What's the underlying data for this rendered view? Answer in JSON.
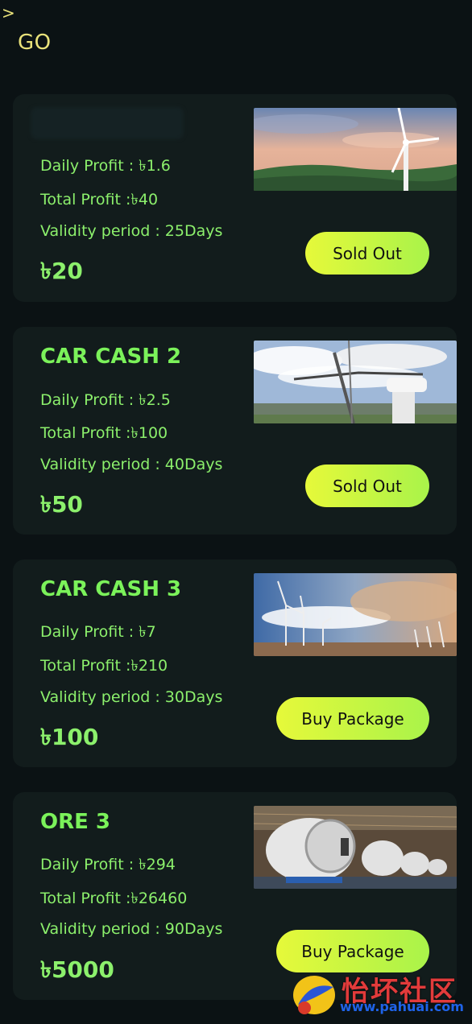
{
  "header": {
    "chevron": ">",
    "go_label": "GO"
  },
  "packages": [
    {
      "title": "",
      "daily_profit": "Daily Profit : ৳1.6",
      "total_profit": "Total Profit :৳40",
      "validity": "Validity period : 25Days",
      "price": "৳20",
      "button": "Sold Out",
      "image": "wind-turbine-sunset"
    },
    {
      "title": "CAR CASH 2",
      "daily_profit": "Daily Profit : ৳2.5",
      "total_profit": "Total Profit :৳100",
      "validity": "Validity period : 40Days",
      "price": "৳50",
      "button": "Sold Out",
      "image": "turbine-crane-construction"
    },
    {
      "title": "CAR CASH 3",
      "daily_profit": "Daily Profit : ৳7",
      "total_profit": "Total Profit :৳210",
      "validity": "Validity period : 30Days",
      "price": "৳100",
      "button": "Buy Package",
      "image": "wind-farm-dusty-sky"
    },
    {
      "title": "ORE 3",
      "daily_profit": "Daily Profit : ৳294",
      "total_profit": "Total Profit :৳26460",
      "validity": "Validity period : 90Days",
      "price": "৳5000",
      "button": "Buy Package",
      "image": "turbine-nacelle-factory"
    }
  ],
  "watermark": {
    "text": "怡坏社区",
    "url": "www.pahuai.com"
  },
  "colors": {
    "background": "#0b1214",
    "card": "#121c1c",
    "accent_green": "#8cf06c",
    "button_gradient_start": "#e6f93a",
    "button_gradient_end": "#a9f34a",
    "header_yellow": "#e9e27a"
  }
}
